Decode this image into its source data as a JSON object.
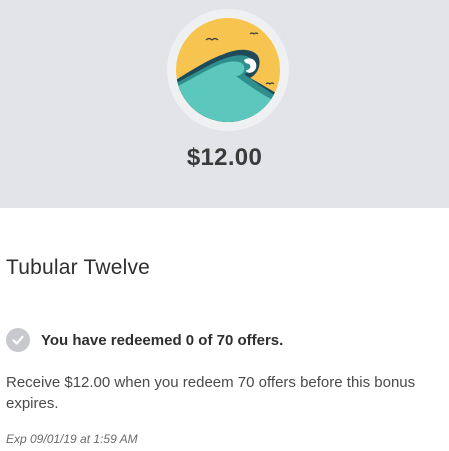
{
  "reward": {
    "amount": "$12.00",
    "icon": "wave-badge-icon"
  },
  "offer": {
    "title": "Tubular Twelve",
    "status": "You have redeemed 0 of 70 offers.",
    "status_icon": "check-circle-icon",
    "description": "Receive $12.00 when you redeem 70 offers before this bonus expires.",
    "expiry": "Exp 09/01/19 at 1:59 AM"
  },
  "colors": {
    "hero_background": "#e3e4e8",
    "badge_sky": "#f8c450",
    "badge_wave": "#5cc7bd",
    "badge_ring": "#eef0f2"
  }
}
